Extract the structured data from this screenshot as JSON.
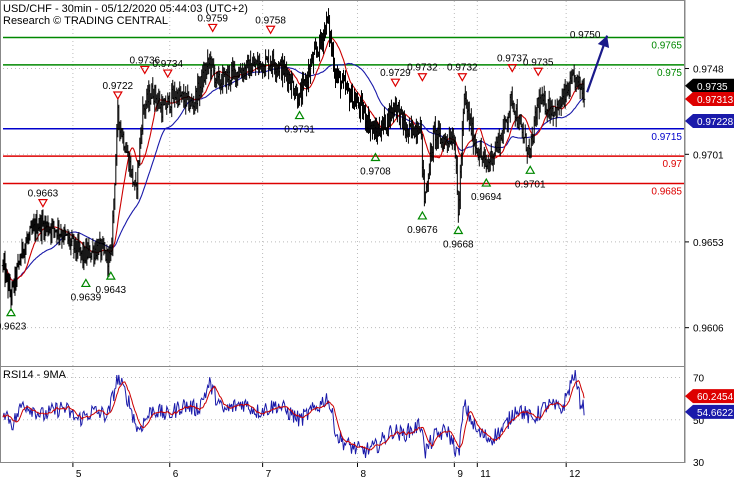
{
  "chart_data": {
    "type": "line",
    "title": "USD/CHF - 30min - 05/12/2020 05:44:03 (UTC+2)",
    "subtitle": "Research © TRADING CENTRAL",
    "ylim": [
      0.9585,
      0.9785
    ],
    "y_ticks": [
      "0.9748",
      "0.9701",
      "0.9653",
      "0.9606"
    ],
    "x_ticks": [
      "5",
      "6",
      "7",
      "8",
      "9",
      "11",
      "12"
    ],
    "x_tick_bars": [
      70,
      167,
      260,
      355,
      452,
      475,
      564
    ],
    "bars_total": 680,
    "price_path": [
      [
        0,
        0.964
      ],
      [
        8,
        0.9623
      ],
      [
        20,
        0.965
      ],
      [
        35,
        0.9663
      ],
      [
        55,
        0.966
      ],
      [
        80,
        0.9645
      ],
      [
        95,
        0.965
      ],
      [
        108,
        0.9643
      ],
      [
        115,
        0.9722
      ],
      [
        125,
        0.97
      ],
      [
        133,
        0.968
      ],
      [
        140,
        0.9725
      ],
      [
        150,
        0.9736
      ],
      [
        160,
        0.9725
      ],
      [
        172,
        0.9734
      ],
      [
        190,
        0.9728
      ],
      [
        207,
        0.9752
      ],
      [
        215,
        0.974
      ],
      [
        230,
        0.9745
      ],
      [
        255,
        0.975
      ],
      [
        270,
        0.9752
      ],
      [
        285,
        0.9745
      ],
      [
        297,
        0.9731
      ],
      [
        310,
        0.9752
      ],
      [
        318,
        0.9762
      ],
      [
        325,
        0.9775
      ],
      [
        333,
        0.9745
      ],
      [
        345,
        0.9735
      ],
      [
        360,
        0.9725
      ],
      [
        373,
        0.9712
      ],
      [
        385,
        0.972
      ],
      [
        393,
        0.9729
      ],
      [
        405,
        0.9712
      ],
      [
        418,
        0.9718
      ],
      [
        422,
        0.9676
      ],
      [
        432,
        0.9713
      ],
      [
        440,
        0.9708
      ],
      [
        452,
        0.9712
      ],
      [
        456,
        0.9668
      ],
      [
        462,
        0.9732
      ],
      [
        472,
        0.9708
      ],
      [
        484,
        0.9694
      ],
      [
        500,
        0.9712
      ],
      [
        510,
        0.9732
      ],
      [
        518,
        0.9715
      ],
      [
        528,
        0.9701
      ],
      [
        536,
        0.973
      ],
      [
        555,
        0.9725
      ],
      [
        572,
        0.9742
      ],
      [
        583,
        0.9735
      ]
    ],
    "series": [
      {
        "name": "",
        "color": "#000000"
      },
      {
        "name": "",
        "color": "#cc0000"
      },
      {
        "name": "",
        "color": "#1a1aaa"
      }
    ],
    "levels": [
      {
        "value": 0.9765,
        "label": "0.9765",
        "color": "#008800"
      },
      {
        "value": 0.975,
        "label": "0.975",
        "color": "#008800"
      },
      {
        "value": 0.9715,
        "label": "0.9715",
        "color": "#0000cc"
      },
      {
        "value": 0.97,
        "label": "0.97",
        "color": "#dd0000"
      },
      {
        "value": 0.9685,
        "label": "0.9685",
        "color": "#dd0000"
      }
    ],
    "price_tags": [
      {
        "value": 0.9735,
        "label": "0.9735",
        "bg": "#000000",
        "fg": "#ffffff"
      },
      {
        "value": 0.97313,
        "label": "0.97313",
        "bg": "#dd0000",
        "fg": "#ffffff"
      },
      {
        "value": 0.97228,
        "label": "0.97228",
        "bg": "#1a1aaa",
        "fg": "#ffffff"
      }
    ],
    "peaks": [
      {
        "bar": 8,
        "value": 0.9623,
        "kind": "low"
      },
      {
        "bar": 40,
        "value": 0.9663,
        "kind": "high"
      },
      {
        "bar": 83,
        "value": 0.9639,
        "kind": "low"
      },
      {
        "bar": 108,
        "value": 0.9643,
        "kind": "low"
      },
      {
        "bar": 115,
        "value": 0.9722,
        "kind": "high"
      },
      {
        "bar": 142,
        "value": 0.9736,
        "kind": "high"
      },
      {
        "bar": 165,
        "value": 0.9734,
        "kind": "high"
      },
      {
        "bar": 210,
        "value": 0.9759,
        "kind": "high"
      },
      {
        "bar": 268,
        "value": 0.9758,
        "kind": "high"
      },
      {
        "bar": 297,
        "value": 0.9731,
        "kind": "low"
      },
      {
        "bar": 373,
        "value": 0.9708,
        "kind": "low"
      },
      {
        "bar": 393,
        "value": 0.9729,
        "kind": "high"
      },
      {
        "bar": 420,
        "value": 0.9676,
        "kind": "low"
      },
      {
        "bar": 420,
        "value": 0.9732,
        "kind": "high"
      },
      {
        "bar": 456,
        "value": 0.9668,
        "kind": "low"
      },
      {
        "bar": 460,
        "value": 0.9732,
        "kind": "high"
      },
      {
        "bar": 484,
        "value": 0.9694,
        "kind": "low"
      },
      {
        "bar": 510,
        "value": 0.9737,
        "kind": "high"
      },
      {
        "bar": 528,
        "value": 0.9701,
        "kind": "low"
      },
      {
        "bar": 536,
        "value": 0.9735,
        "kind": "high"
      }
    ],
    "peak_labels": [
      {
        "bar": 8,
        "value": 0.9623,
        "label": "0.9623"
      },
      {
        "bar": 40,
        "value": 0.9663,
        "label": "0.9663"
      },
      {
        "bar": 83,
        "value": 0.9639,
        "label": "0.9639"
      },
      {
        "bar": 108,
        "value": 0.9643,
        "label": "0.9643"
      },
      {
        "bar": 115,
        "value": 0.9722,
        "label": "0.9722"
      },
      {
        "bar": 142,
        "value": 0.9736,
        "label": "0.9736"
      },
      {
        "bar": 165,
        "value": 0.9734,
        "label": "0.9734"
      },
      {
        "bar": 210,
        "value": 0.9759,
        "label": "0.9759"
      },
      {
        "bar": 268,
        "value": 0.9758,
        "label": "0.9758"
      },
      {
        "bar": 297,
        "value": 0.9731,
        "label": "0.9731"
      },
      {
        "bar": 373,
        "value": 0.9708,
        "label": "0.9708"
      },
      {
        "bar": 393,
        "value": 0.9729,
        "label": "0.9729"
      },
      {
        "bar": 420,
        "value": 0.9676,
        "label": "0.9676"
      },
      {
        "bar": 420,
        "value": 0.9732,
        "label": "0.9732"
      },
      {
        "bar": 456,
        "value": 0.9668,
        "label": "0.9668"
      },
      {
        "bar": 460,
        "value": 0.9732,
        "label": "0.9732"
      },
      {
        "bar": 484,
        "value": 0.9694,
        "label": "0.9694"
      },
      {
        "bar": 510,
        "value": 0.9737,
        "label": "0.9737"
      },
      {
        "bar": 528,
        "value": 0.9701,
        "label": "0.9701"
      },
      {
        "bar": 536,
        "value": 0.9735,
        "label": "0.9735"
      },
      {
        "bar": 583,
        "value": 0.975,
        "label": "0.9750"
      }
    ],
    "forecast": {
      "from_bar": 585,
      "from_value": 0.9735,
      "to_bar": 605,
      "to_value": 0.9766
    },
    "rsi": {
      "title": "RSI14 - 9MA",
      "ylim": [
        30,
        75
      ],
      "y_ticks": [
        "70",
        "50",
        "30"
      ],
      "path": [
        [
          0,
          55
        ],
        [
          10,
          48
        ],
        [
          20,
          58
        ],
        [
          40,
          52
        ],
        [
          60,
          56
        ],
        [
          75,
          50
        ],
        [
          90,
          54
        ],
        [
          105,
          52
        ],
        [
          115,
          70
        ],
        [
          125,
          60
        ],
        [
          135,
          45
        ],
        [
          150,
          55
        ],
        [
          165,
          52
        ],
        [
          180,
          57
        ],
        [
          195,
          55
        ],
        [
          207,
          67
        ],
        [
          220,
          54
        ],
        [
          240,
          58
        ],
        [
          255,
          54
        ],
        [
          275,
          57
        ],
        [
          297,
          50
        ],
        [
          315,
          56
        ],
        [
          325,
          61
        ],
        [
          335,
          42
        ],
        [
          345,
          38
        ],
        [
          360,
          35
        ],
        [
          373,
          37
        ],
        [
          390,
          45
        ],
        [
          400,
          43
        ],
        [
          420,
          48
        ],
        [
          422,
          34
        ],
        [
          432,
          42
        ],
        [
          445,
          45
        ],
        [
          456,
          33
        ],
        [
          462,
          57
        ],
        [
          475,
          44
        ],
        [
          488,
          41
        ],
        [
          500,
          45
        ],
        [
          515,
          56
        ],
        [
          530,
          50
        ],
        [
          545,
          57
        ],
        [
          560,
          55
        ],
        [
          572,
          72
        ],
        [
          578,
          59
        ],
        [
          583,
          55
        ]
      ],
      "tags": [
        {
          "value": 60.2454,
          "label": "60.2454",
          "bg": "#dd0000",
          "fg": "#ffffff"
        },
        {
          "value": 54.6622,
          "label": "54.6622",
          "bg": "#1a1aaa",
          "fg": "#ffffff"
        }
      ]
    }
  }
}
